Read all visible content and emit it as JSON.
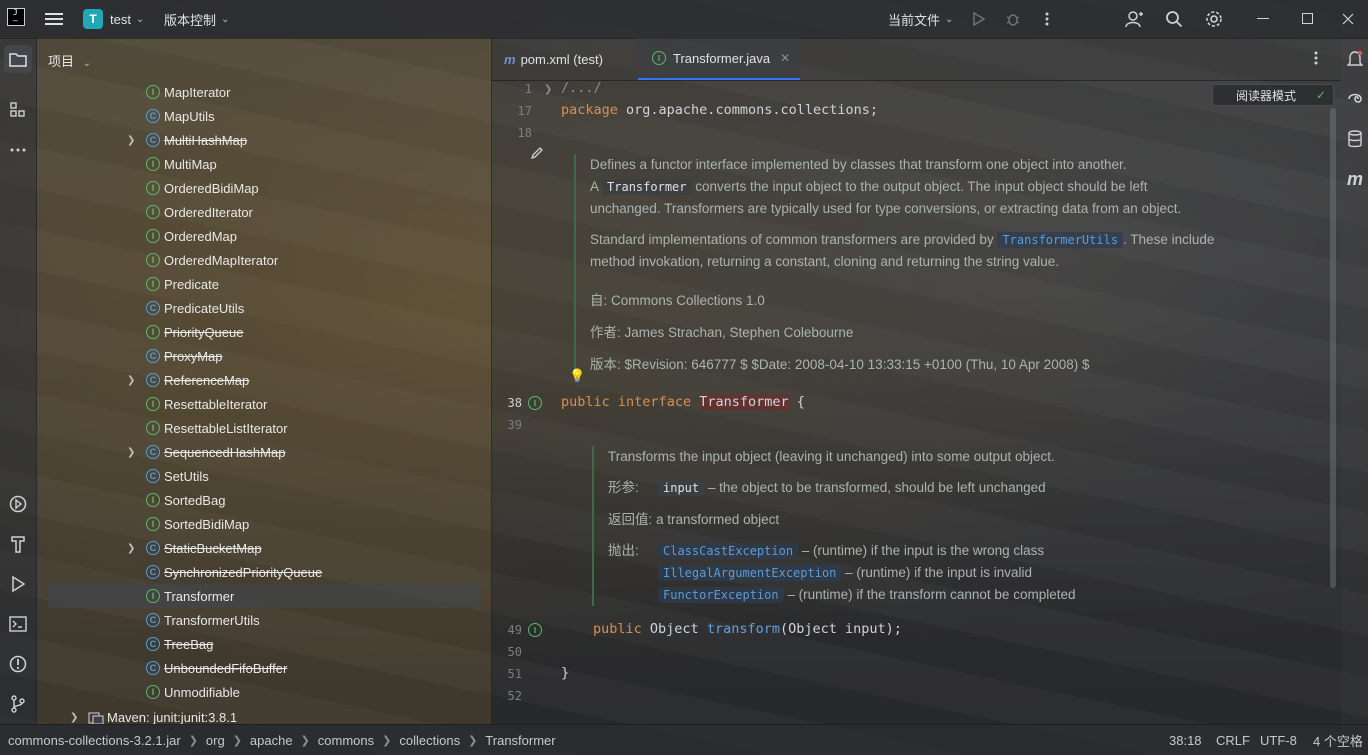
{
  "topbar": {
    "project_initial": "T",
    "project_name": "test",
    "vcs_label": "版本控制",
    "run_config": "当前文件"
  },
  "project_panel": {
    "title": "项目",
    "items": [
      {
        "name": "MapIterator",
        "kind": "interface",
        "deprecated": false,
        "expandable": false
      },
      {
        "name": "MapUtils",
        "kind": "class",
        "deprecated": false,
        "expandable": false
      },
      {
        "name": "MultiHashMap",
        "kind": "class",
        "deprecated": true,
        "expandable": true
      },
      {
        "name": "MultiMap",
        "kind": "interface",
        "deprecated": false,
        "expandable": false
      },
      {
        "name": "OrderedBidiMap",
        "kind": "interface",
        "deprecated": false,
        "expandable": false
      },
      {
        "name": "OrderedIterator",
        "kind": "interface",
        "deprecated": false,
        "expandable": false
      },
      {
        "name": "OrderedMap",
        "kind": "interface",
        "deprecated": false,
        "expandable": false
      },
      {
        "name": "OrderedMapIterator",
        "kind": "interface",
        "deprecated": false,
        "expandable": false
      },
      {
        "name": "Predicate",
        "kind": "interface",
        "deprecated": false,
        "expandable": false
      },
      {
        "name": "PredicateUtils",
        "kind": "class",
        "deprecated": false,
        "expandable": false
      },
      {
        "name": "PriorityQueue",
        "kind": "interface",
        "deprecated": true,
        "expandable": false
      },
      {
        "name": "ProxyMap",
        "kind": "class",
        "deprecated": true,
        "expandable": false
      },
      {
        "name": "ReferenceMap",
        "kind": "class",
        "deprecated": true,
        "expandable": true
      },
      {
        "name": "ResettableIterator",
        "kind": "interface",
        "deprecated": false,
        "expandable": false
      },
      {
        "name": "ResettableListIterator",
        "kind": "interface",
        "deprecated": false,
        "expandable": false
      },
      {
        "name": "SequencedHashMap",
        "kind": "class",
        "deprecated": true,
        "expandable": true
      },
      {
        "name": "SetUtils",
        "kind": "class",
        "deprecated": false,
        "expandable": false
      },
      {
        "name": "SortedBag",
        "kind": "interface",
        "deprecated": false,
        "expandable": false
      },
      {
        "name": "SortedBidiMap",
        "kind": "interface",
        "deprecated": false,
        "expandable": false
      },
      {
        "name": "StaticBucketMap",
        "kind": "class",
        "deprecated": true,
        "expandable": true
      },
      {
        "name": "SynchronizedPriorityQueue",
        "kind": "class",
        "deprecated": true,
        "expandable": false
      },
      {
        "name": "Transformer",
        "kind": "interface",
        "deprecated": false,
        "expandable": false,
        "selected": true
      },
      {
        "name": "TransformerUtils",
        "kind": "class",
        "deprecated": false,
        "expandable": false
      },
      {
        "name": "TreeBag",
        "kind": "class",
        "deprecated": true,
        "expandable": false
      },
      {
        "name": "UnboundedFifoBuffer",
        "kind": "class",
        "deprecated": true,
        "expandable": false
      },
      {
        "name": "Unmodifiable",
        "kind": "interface",
        "deprecated": false,
        "expandable": false
      }
    ],
    "maven_label": "Maven: junit:junit:3.8.1"
  },
  "tabs": [
    {
      "label": "pom.xml (test)",
      "active": false
    },
    {
      "label": "Transformer.java",
      "active": true
    }
  ],
  "editor": {
    "reader_mode": "阅读器模式",
    "line_numbers": {
      "l1": "1",
      "l17": "17",
      "l18": "18",
      "l38": "38",
      "l39": "39",
      "l49": "49",
      "l50": "50",
      "l51": "51",
      "l52": "52"
    },
    "folded": "/.../",
    "package_kw": "package",
    "package_name": " org.apache.commons.collections;",
    "doc1": {
      "line1": "Defines a functor interface implemented by classes that transform one object into another.",
      "a": "A ",
      "code_transformer": "Transformer",
      "line2_rest": " converts the input object to the output object. The input object should be left",
      "line3": "unchanged. Transformers are typically used for type conversions, or extracting data from an object.",
      "p2a": "Standard implementations of common transformers are provided by ",
      "code_utils": "TransformerUtils",
      "p2b": ". These include",
      "p2c": "method invokation, returning a constant, cloning and returning the string value.",
      "since": "自:   Commons Collections 1.0",
      "author": "作者: James Strachan, Stephen Colebourne",
      "version": "版本: $Revision: 646777 $ $Date: 2008-04-10 13:33:15 +0100 (Thu, 10 Apr 2008) $"
    },
    "decl_public": "public",
    "decl_interface": "interface",
    "decl_name": "Transformer",
    "decl_brace": " {",
    "doc2": {
      "line1": "Transforms the input object (leaving it unchanged) into some output object.",
      "param_label": "形参:",
      "param_code": "input",
      "param_desc": " – the object to be transformed, should be left unchanged",
      "return_label": "返回值:",
      "return_desc": "a transformed object",
      "throws_label": "抛出:",
      "ex1": "ClassCastException",
      "ex1_desc": " – (runtime) if the input is the wrong class",
      "ex2": "IllegalArgumentException",
      "ex2_desc": " – (runtime) if the input is invalid",
      "ex3": "FunctorException",
      "ex3_desc": " – (runtime) if the transform cannot be completed"
    },
    "method_public": "public",
    "method_type": " Object ",
    "method_name": "transform",
    "method_args": "(Object input);",
    "close_brace": "}"
  },
  "statusbar": {
    "breadcrumb": [
      "commons-collections-3.2.1.jar",
      "org",
      "apache",
      "commons",
      "collections",
      "Transformer"
    ],
    "position": "38:18",
    "line_sep": "CRLF",
    "encoding": "UTF-8",
    "indent": "4 个空格"
  }
}
